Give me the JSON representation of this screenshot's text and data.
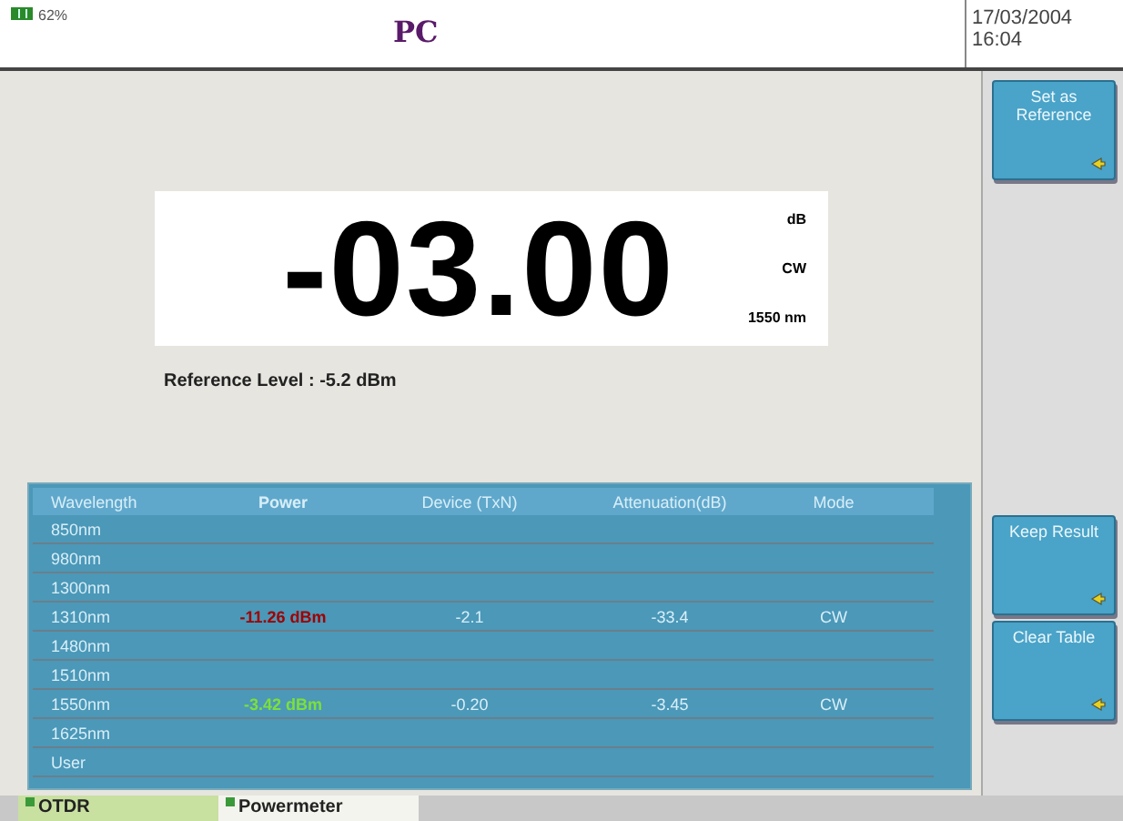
{
  "status": {
    "battery": "62%",
    "logo": "PC",
    "date": "17/03/2004",
    "time": "16:04"
  },
  "reading": {
    "value": "-03.00",
    "unit": "dB",
    "mode": "CW",
    "wavelength": "1550 nm"
  },
  "reference": "Reference Level :  -5.2 dBm",
  "table": {
    "columns": [
      "Wavelength",
      "Power",
      "Device (TxN)",
      "Attenuation(dB)",
      "Mode"
    ],
    "rows": [
      {
        "cells": [
          "850nm",
          "",
          "",
          "",
          ""
        ]
      },
      {
        "cells": [
          "980nm",
          "",
          "",
          "",
          ""
        ]
      },
      {
        "cells": [
          "1300nm",
          "",
          "",
          "",
          ""
        ]
      },
      {
        "cells": [
          "1310nm",
          "-11.26 dBm",
          "-2.1",
          "-33.4",
          "CW"
        ],
        "color": "#a00000"
      },
      {
        "cells": [
          "1480nm",
          "",
          "",
          "",
          ""
        ]
      },
      {
        "cells": [
          "1510nm",
          "",
          "",
          "",
          ""
        ]
      },
      {
        "cells": [
          "1550nm",
          "-3.42 dBm",
          "-0.20",
          "-3.45",
          "CW"
        ],
        "color": "#7de03a"
      },
      {
        "cells": [
          "1625nm",
          "",
          "",
          "",
          ""
        ]
      },
      {
        "cells": [
          "User",
          "",
          "",
          "",
          ""
        ]
      }
    ]
  },
  "top_buttons": [
    "Set as Reference"
  ],
  "bottom_buttons": [
    "Keep Result",
    "Clear Table"
  ],
  "tabs": [
    {
      "label": "OTDR",
      "selected": false
    },
    {
      "label": "Powermeter",
      "selected": true
    }
  ]
}
